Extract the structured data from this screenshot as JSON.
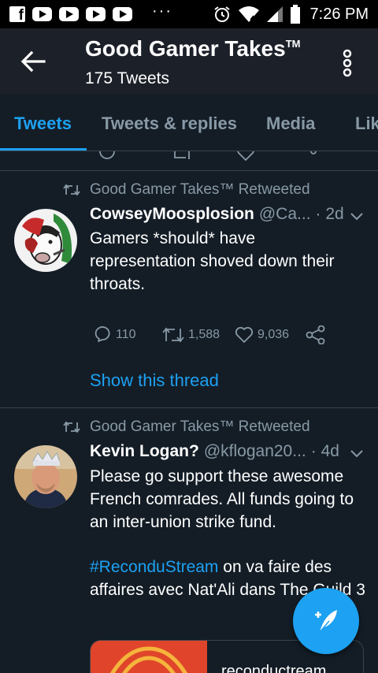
{
  "status_bar": {
    "time": "7:26 PM",
    "icons": [
      "facebook-icon",
      "youtube-icon",
      "youtube-icon",
      "youtube-icon",
      "youtube-icon",
      "more-notifications-icon",
      "alarm-icon",
      "wifi-icon",
      "signal-icon",
      "battery-icon"
    ]
  },
  "header": {
    "title": "Good Gamer Takes",
    "title_mark": "TM",
    "subtitle": "175 Tweets"
  },
  "tabs": [
    {
      "label": "Tweets",
      "active": true
    },
    {
      "label": "Tweets & replies",
      "active": false
    },
    {
      "label": "Media",
      "active": false
    },
    {
      "label": "Lik",
      "active": false
    }
  ],
  "tweets": [
    {
      "retweeted_by": "Good Gamer Takes™ Retweeted",
      "name": "CowseyMoosplosion",
      "handle": "@Ca...",
      "time": "· 2d",
      "body": "Gamers *should* have representation shoved down their throats.",
      "replies": "110",
      "retweets": "1,588",
      "likes": "9,036",
      "show_thread": "Show this thread"
    },
    {
      "retweeted_by": "Good Gamer Takes™ Retweeted",
      "name": "Kevin Logan?",
      "handle": "@kflogan20...",
      "time": "· 4d",
      "body": "Please go support these awesome French comrades. All funds going to an inter-union strike fund.",
      "hashtag": "#ReconduStream",
      "body_after_hashtag": " on va faire des affaires avec Nat'Ali dans The Guild 3",
      "card_text": "reconductream"
    }
  ],
  "colors": {
    "accent": "#1da1f2",
    "background": "#141d26",
    "header_bg": "#1c2029",
    "muted": "#8899a6",
    "border": "#38444d"
  }
}
